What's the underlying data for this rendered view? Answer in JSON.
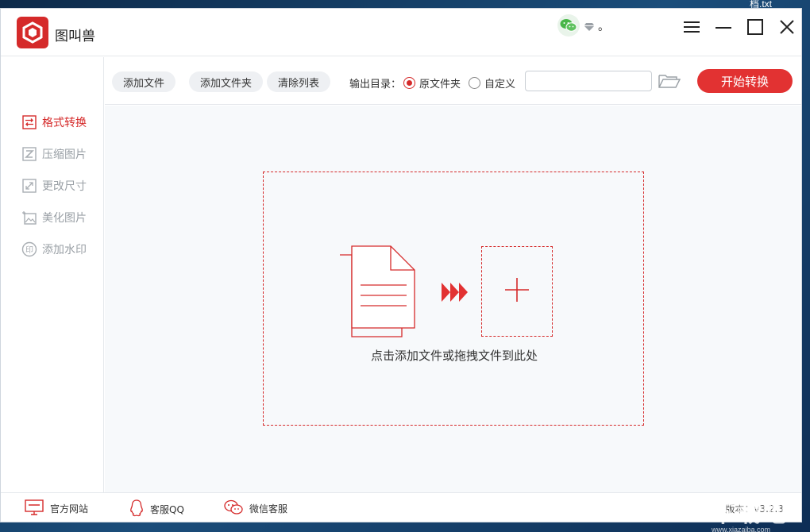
{
  "desktop": {
    "file_label": "档.txt"
  },
  "app": {
    "title": "图叫兽",
    "user_suffix": "。"
  },
  "colors": {
    "accent": "#d52a2a",
    "start_button": "#e23232",
    "sidebar_inactive": "#9aa0a6"
  },
  "sidebar": {
    "items": [
      {
        "label": "格式转换",
        "icon": "swap-arrows-icon",
        "active": true
      },
      {
        "label": "压缩图片",
        "icon": "compress-icon",
        "active": false
      },
      {
        "label": "更改尺寸",
        "icon": "resize-icon",
        "active": false
      },
      {
        "label": "美化图片",
        "icon": "beautify-icon",
        "active": false
      },
      {
        "label": "添加水印",
        "icon": "watermark-icon",
        "active": false
      }
    ]
  },
  "toolbar": {
    "add_file": "添加文件",
    "add_folder": "添加文件夹",
    "clear_list": "清除列表",
    "output_label": "输出目录：",
    "radio_original": "原文件夹",
    "radio_custom": "自定义",
    "selected_output": "原文件夹",
    "path_value": "",
    "start": "开始转换"
  },
  "content": {
    "drop_text": "点击添加文件或拖拽文件到此处"
  },
  "footer": {
    "website": "官方网站",
    "qq": "客服QQ",
    "wechat": "微信客服",
    "version": "版本：v3.2.3"
  },
  "watermark": {
    "main": "下载吧",
    "sub": "www.xiazaiba.com"
  }
}
